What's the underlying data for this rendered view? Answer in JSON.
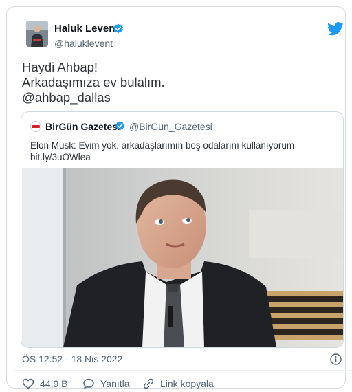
{
  "tweet": {
    "author_name": "Haluk Levent",
    "author_handle": "@haluklevent",
    "text_lines": [
      "Haydi Ahbap!",
      "Arkadaşımıza ev bulalım.",
      "@ahbap_dallas"
    ],
    "timestamp": "ÖS 12:52 · 18 Nis 2022"
  },
  "quote": {
    "author_name": "BirGün Gazetesi",
    "author_handle": "@BirGun_Gazetesi",
    "text": "Elon Musk: Evim yok, arkadaşlarımın boş odalarını kullanıyorum",
    "link": "bit.ly/3uOWlea"
  },
  "actions": {
    "like_count": "44,9 B",
    "reply_label": "Yanıtla",
    "copy_link_label": "Link kopyala"
  },
  "icons": {
    "brand": "twitter-bird-icon",
    "verified": "verified-badge-icon",
    "info": "info-icon",
    "like": "heart-icon",
    "reply": "speech-bubble-icon",
    "copy": "link-icon"
  },
  "colors": {
    "brand_blue": "#1d9bf0",
    "text": "#0f1419",
    "muted": "#536471",
    "border": "#cfd9de"
  }
}
